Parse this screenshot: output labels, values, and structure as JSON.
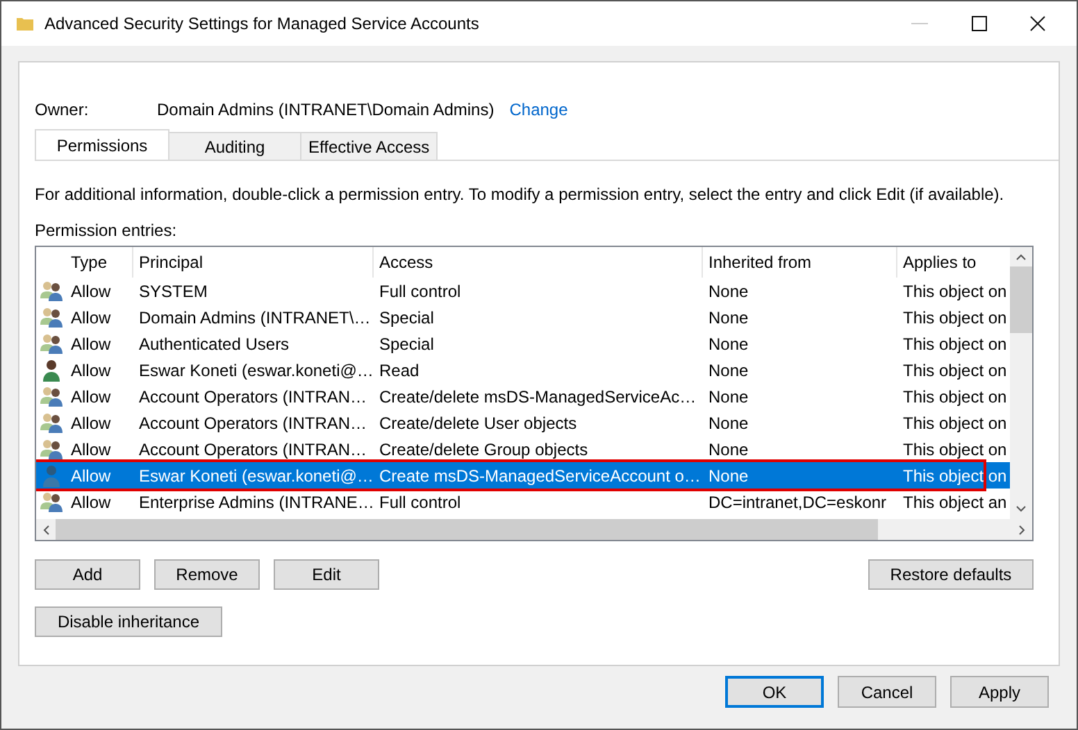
{
  "window": {
    "title": "Advanced Security Settings for Managed Service Accounts"
  },
  "owner": {
    "label": "Owner:",
    "value": "Domain Admins (INTRANET\\Domain Admins)",
    "link": "Change"
  },
  "tabs": [
    {
      "label": "Permissions",
      "selected": true
    },
    {
      "label": "Auditing",
      "selected": false
    },
    {
      "label": "Effective Access",
      "selected": false
    }
  ],
  "info": "For additional information, double-click a permission entry. To modify a permission entry, select the entry and click Edit (if available).",
  "entries_label": "Permission entries:",
  "table": {
    "columns": [
      "Type",
      "Principal",
      "Access",
      "Inherited from",
      "Applies to"
    ],
    "rows": [
      {
        "kind": "group",
        "type": "Allow",
        "principal": "SYSTEM",
        "access": "Full control",
        "inherited": "None",
        "applies": "This object on",
        "selected": false,
        "highlighted": false
      },
      {
        "kind": "group",
        "type": "Allow",
        "principal": "Domain Admins (INTRANET\\…",
        "access": "Special",
        "inherited": "None",
        "applies": "This object on",
        "selected": false,
        "highlighted": false
      },
      {
        "kind": "group",
        "type": "Allow",
        "principal": "Authenticated Users",
        "access": "Special",
        "inherited": "None",
        "applies": "This object on",
        "selected": false,
        "highlighted": false
      },
      {
        "kind": "user",
        "type": "Allow",
        "principal": "Eswar Koneti (eswar.koneti@…",
        "access": "Read",
        "inherited": "None",
        "applies": "This object on",
        "selected": false,
        "highlighted": false
      },
      {
        "kind": "group",
        "type": "Allow",
        "principal": "Account Operators (INTRAN…",
        "access": "Create/delete msDS-ManagedServiceAc…",
        "inherited": "None",
        "applies": "This object on",
        "selected": false,
        "highlighted": false
      },
      {
        "kind": "group",
        "type": "Allow",
        "principal": "Account Operators (INTRAN…",
        "access": "Create/delete User objects",
        "inherited": "None",
        "applies": "This object on",
        "selected": false,
        "highlighted": false
      },
      {
        "kind": "group",
        "type": "Allow",
        "principal": "Account Operators (INTRAN…",
        "access": "Create/delete Group objects",
        "inherited": "None",
        "applies": "This object on",
        "selected": false,
        "highlighted": false
      },
      {
        "kind": "user",
        "type": "Allow",
        "principal": "Eswar Koneti (eswar.koneti@…",
        "access": "Create msDS-ManagedServiceAccount o…",
        "inherited": "None",
        "applies": "This object on",
        "selected": true,
        "highlighted": true
      },
      {
        "kind": "group",
        "type": "Allow",
        "principal": "Enterprise Admins (INTRANE…",
        "access": "Full control",
        "inherited": "DC=intranet,DC=eskonr",
        "applies": "This object an",
        "selected": false,
        "highlighted": false
      }
    ]
  },
  "list_buttons": [
    "Add",
    "Remove",
    "Edit"
  ],
  "restore_button": "Restore defaults",
  "inheritance_button": "Disable inheritance",
  "dialog_buttons": [
    {
      "label": "OK",
      "default": true
    },
    {
      "label": "Cancel",
      "default": false
    },
    {
      "label": "Apply",
      "default": false
    }
  ]
}
